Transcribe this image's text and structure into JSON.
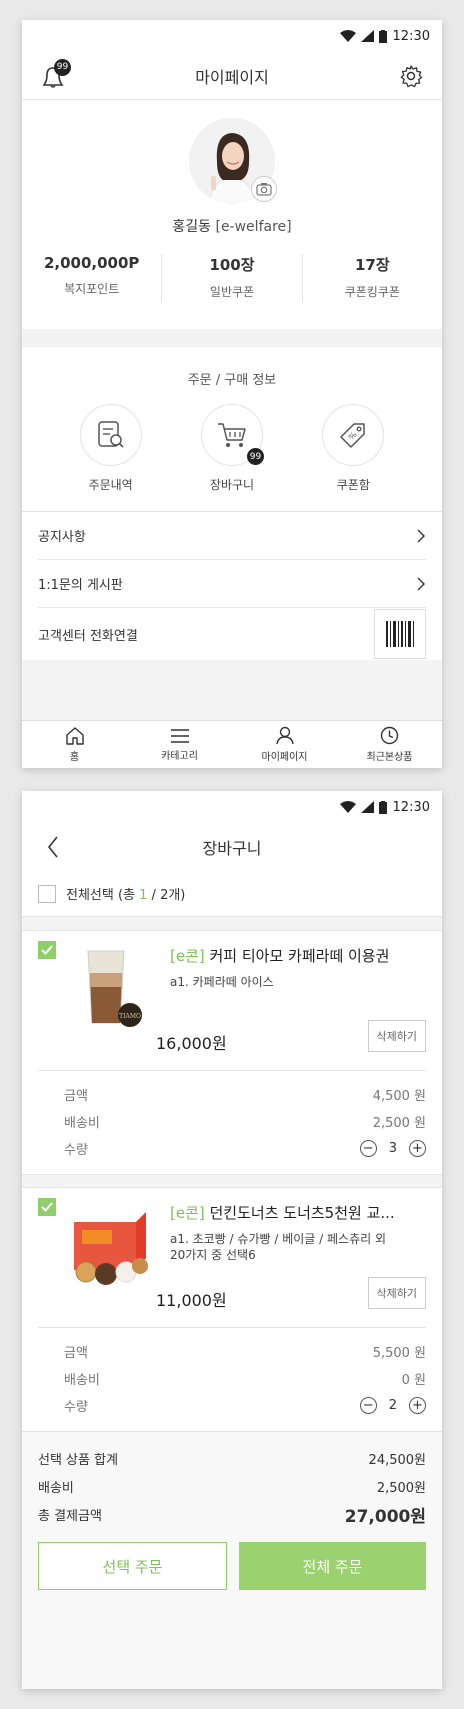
{
  "status_bar": {
    "time": "12:30"
  },
  "mypage": {
    "title": "마이페이지",
    "notification_badge": "99",
    "profile": {
      "name": "홍길동",
      "id": "[e-welfare]"
    },
    "stats": [
      {
        "value": "2,000,000P",
        "label": "복지포인트"
      },
      {
        "value": "100장",
        "label": "일반쿠폰"
      },
      {
        "value": "17장",
        "label": "쿠폰킹쿠폰"
      }
    ],
    "orders": {
      "title": "주문 / 구매 정보",
      "items": [
        {
          "label": "주문내역",
          "icon": "order-history-icon"
        },
        {
          "label": "장바구니",
          "icon": "cart-icon",
          "badge": "99"
        },
        {
          "label": "쿠폰함",
          "icon": "coupon-icon"
        }
      ]
    },
    "menu": [
      {
        "label": "공지사항"
      },
      {
        "label": "1:1문의 게시판"
      },
      {
        "label": "고객센터 전화연결"
      }
    ],
    "tabs": [
      {
        "label": "홈",
        "icon": "home-icon"
      },
      {
        "label": "카테고리",
        "icon": "menu-icon"
      },
      {
        "label": "마이페이지",
        "icon": "person-icon"
      },
      {
        "label": "최근본상품",
        "icon": "clock-icon"
      }
    ]
  },
  "cart": {
    "title": "장바구니",
    "select_all": {
      "prefix": "전체선택 (총 ",
      "selected": "1",
      "suffix": " / 2개)"
    },
    "items": [
      {
        "tag": "[e콘]",
        "name": " 커피 티아모 카페라떼 이용권",
        "option": "a1. 카페라떼 아이스",
        "option2": "",
        "price": "16,000원",
        "delete_label": "삭제하기",
        "amount_label": "금액",
        "amount": "4,500 원",
        "shipping_label": "배송비",
        "shipping": "2,500 원",
        "qty_label": "수량",
        "qty": "3",
        "checked": true
      },
      {
        "tag": "[e콘]",
        "name": " 던킨도너츠 도너츠5천원 교...",
        "option": "a1. 초코빵 / 슈가빵 / 베이글 / 페스츄리 외",
        "option2": "20가지 중 선택6",
        "price": "11,000원",
        "delete_label": "삭제하기",
        "amount_label": "금액",
        "amount": "5,500 원",
        "shipping_label": "배송비",
        "shipping": "0 원",
        "qty_label": "수량",
        "qty": "2",
        "checked": true
      }
    ],
    "summary": {
      "subtotal_label": "선택 상품 합계",
      "subtotal": "24,500원",
      "shipping_label": "배송비",
      "shipping": "2,500원",
      "total_label": "총 결제금액",
      "total": "27,000원"
    },
    "buttons": {
      "select_order": "선택 주문",
      "all_order": "전체 주문"
    }
  },
  "colors": {
    "accent": "#8fcf6a",
    "accent_text": "#7cc256"
  }
}
